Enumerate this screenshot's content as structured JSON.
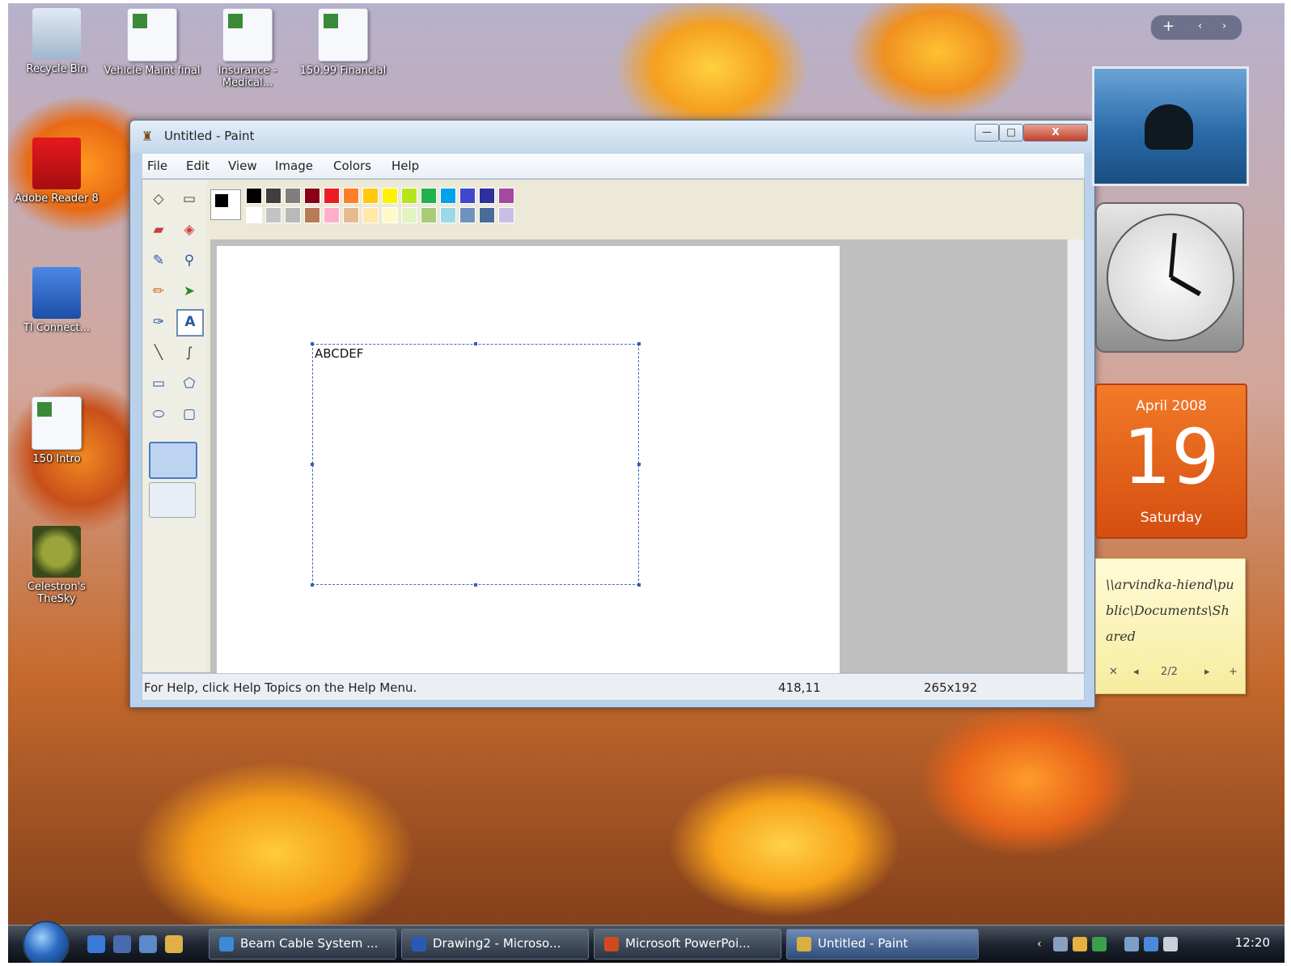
{
  "desktop": {
    "icons": [
      {
        "label": "Recycle Bin"
      },
      {
        "label": "Vehicle Maint final"
      },
      {
        "label": "Insurance - Medical..."
      },
      {
        "label": "150.99 Financial"
      },
      {
        "label": "Adobe Reader 8"
      },
      {
        "label": "TI Connect..."
      },
      {
        "label": "150 Intro"
      },
      {
        "label": "Celestron's TheSky"
      }
    ]
  },
  "paint": {
    "title": "Untitled - Paint",
    "menus": [
      "File",
      "Edit",
      "View",
      "Image",
      "Colors",
      "Help"
    ],
    "window_buttons": {
      "minimize": "—",
      "maximize": "□",
      "close": "X"
    },
    "canvas_text": "ABCDEF",
    "status": {
      "help": "For Help, click Help Topics on the Help Menu.",
      "coords": "418,11",
      "size": "265x192"
    },
    "palette_top": [
      "#000000",
      "#3f3f3f",
      "#7f7f7f",
      "#880015",
      "#ed1c24",
      "#ff7f27",
      "#ffc90e",
      "#fff200",
      "#b5e61d",
      "#22b14c",
      "#00a2e8",
      "#3f48cc",
      "#2f2f9f",
      "#a349a4"
    ],
    "palette_bottom": [
      "#ffffff",
      "#c3c3c3",
      "#b9b9b9",
      "#b97a57",
      "#ffaec9",
      "#e8b88e",
      "#ffe8a8",
      "#fff8c8",
      "#e0f5c0",
      "#a8cc78",
      "#99d9ea",
      "#7092be",
      "#4a6a9a",
      "#c8bfe7"
    ],
    "tools": [
      {
        "name": "free-select-tool",
        "icon": "free-select-icon",
        "glyph": "◇"
      },
      {
        "name": "rect-select-tool",
        "icon": "rect-select-icon",
        "glyph": "▭"
      },
      {
        "name": "eraser-tool",
        "icon": "eraser-icon",
        "glyph": "▰"
      },
      {
        "name": "fill-tool",
        "icon": "fill-bucket-icon",
        "glyph": "◈"
      },
      {
        "name": "color-picker-tool",
        "icon": "eyedropper-icon",
        "glyph": "✎"
      },
      {
        "name": "magnifier-tool",
        "icon": "magnifier-icon",
        "glyph": "⚲"
      },
      {
        "name": "pencil-tool",
        "icon": "pencil-icon",
        "glyph": "✏"
      },
      {
        "name": "brush-tool",
        "icon": "brush-icon",
        "glyph": "➤"
      },
      {
        "name": "airbrush-tool",
        "icon": "airbrush-icon",
        "glyph": "✑"
      },
      {
        "name": "text-tool",
        "icon": "text-icon",
        "glyph": "A"
      },
      {
        "name": "line-tool",
        "icon": "line-icon",
        "glyph": "╲"
      },
      {
        "name": "curve-tool",
        "icon": "curve-icon",
        "glyph": "∫"
      },
      {
        "name": "rectangle-tool",
        "icon": "rectangle-icon",
        "glyph": "▭"
      },
      {
        "name": "polygon-tool",
        "icon": "polygon-icon",
        "glyph": "⬠"
      },
      {
        "name": "ellipse-tool",
        "icon": "ellipse-icon",
        "glyph": "⬭"
      },
      {
        "name": "rounded-rect-tool",
        "icon": "rounded-rect-icon",
        "glyph": "▢"
      }
    ]
  },
  "gadgets": {
    "calendar": {
      "month": "April 2008",
      "day": "19",
      "weekday": "Saturday"
    },
    "notes": {
      "text": "\\\\arvindka-hiend\\public\\Documents\\Shared",
      "page": "2/2"
    }
  },
  "taskbar": {
    "tasks": [
      {
        "label": "Beam Cable System ...",
        "color": "#3a8ad8"
      },
      {
        "label": "Drawing2 - Microso...",
        "color": "#2a5ab8"
      },
      {
        "label": "Microsoft PowerPoi...",
        "color": "#d04a20"
      },
      {
        "label": "Untitled - Paint",
        "color": "#d8b040"
      }
    ],
    "time": "12:20"
  }
}
